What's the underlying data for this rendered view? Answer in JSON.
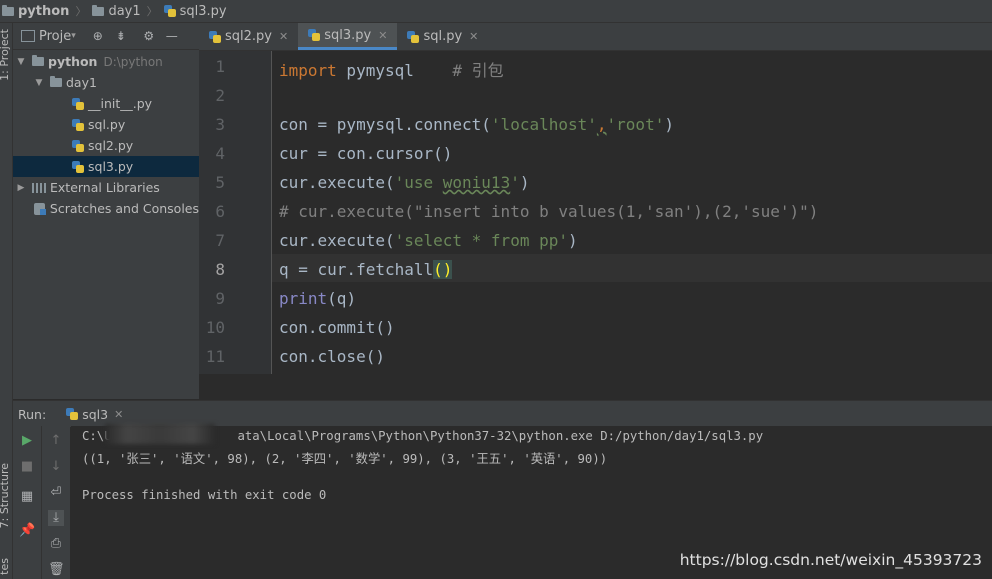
{
  "breadcrumb": {
    "root": "python",
    "folder": "day1",
    "file": "sql3.py"
  },
  "left_strip": {
    "project_tab": "1: Project",
    "structure_tab": "7: Structure",
    "favorites_tab": "tes"
  },
  "project_panel": {
    "header_label": "Proje",
    "tree": [
      {
        "label": "python",
        "hint": "D:\\python"
      },
      {
        "label": "day1"
      },
      {
        "label": "__init__.py"
      },
      {
        "label": "sql.py"
      },
      {
        "label": "sql2.py"
      },
      {
        "label": "sql3.py"
      },
      {
        "label": "External Libraries"
      },
      {
        "label": "Scratches and Consoles"
      }
    ]
  },
  "tabs": [
    {
      "label": "sql2.py"
    },
    {
      "label": "sql3.py"
    },
    {
      "label": "sql.py"
    }
  ],
  "editor": {
    "line_numbers": [
      "1",
      "2",
      "3",
      "4",
      "5",
      "6",
      "7",
      "8",
      "9",
      "10",
      "11"
    ],
    "lines": {
      "l1_kw": "import",
      "l1_mod": " pymysql",
      "l1_cm": "    # 引包",
      "l3_a": "con = pymysql.connect(",
      "l3_s1": "'localhost'",
      "l3_comma": ",",
      "l3_s2": "'root'",
      "l3_b": ")",
      "l4": "cur = con.cursor()",
      "l5_a": "cur.execute(",
      "l5_s1": "'use ",
      "l5_s2": "woniu13",
      "l5_s3": "'",
      "l5_b": ")",
      "l6": "# cur.execute(\"insert into b values(1,'san'),(2,'sue')\")",
      "l7_a": "cur.execute(",
      "l7_s": "'select * from pp'",
      "l7_b": ")",
      "l8_a": "q = cur.fetchall",
      "l8_b": "()",
      "l9_a": "print",
      "l9_b": "(q)",
      "l10": "con.commit()",
      "l11": "con.close()"
    }
  },
  "run_panel": {
    "label": "Run:",
    "tab": "sql3",
    "console_lines": [
      "C:\\U                 ata\\Local\\Programs\\Python\\Python37-32\\python.exe D:/python/day1/sql3.py",
      "((1, '张三', '语文', 98), (2, '李四', '数学', 99), (3, '王五', '英语', 90))",
      "",
      "Process finished with exit code 0"
    ]
  },
  "watermark": "https://blog.csdn.net/weixin_45393723"
}
